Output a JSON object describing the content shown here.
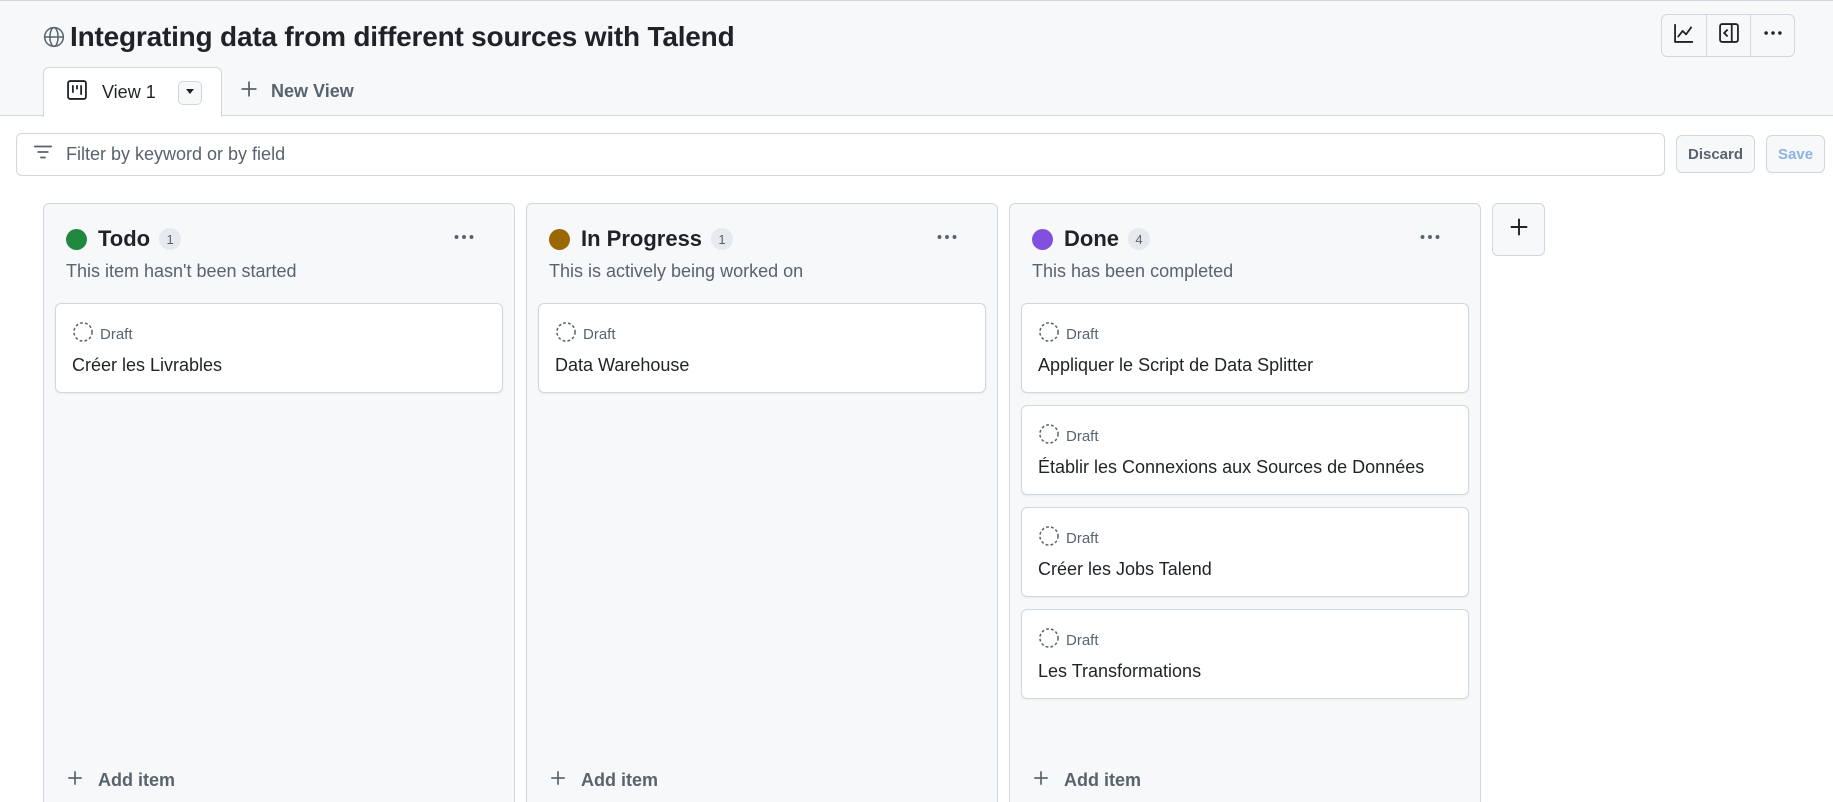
{
  "header": {
    "title": "Integrating data from different sources with Talend",
    "toolbar": [
      "insights-icon",
      "side-panel-icon",
      "kebab-icon"
    ]
  },
  "tabs": {
    "active_label": "View 1",
    "new_view_label": "New View"
  },
  "filter": {
    "placeholder": "Filter by keyword or by field",
    "discard_label": "Discard",
    "save_label": "Save"
  },
  "columns": [
    {
      "name": "Todo",
      "count": "1",
      "color": "#1f883d",
      "description": "This item hasn't been started",
      "add_label": "Add item",
      "cards": [
        {
          "status": "Draft",
          "title": "Créer les Livrables"
        }
      ]
    },
    {
      "name": "In Progress",
      "count": "1",
      "color": "#9a6700",
      "description": "This is actively being worked on",
      "add_label": "Add item",
      "cards": [
        {
          "status": "Draft",
          "title": "Data Warehouse"
        }
      ]
    },
    {
      "name": "Done",
      "count": "4",
      "color": "#8250df",
      "description": "This has been completed",
      "add_label": "Add item",
      "cards": [
        {
          "status": "Draft",
          "title": "Appliquer le Script de Data Splitter"
        },
        {
          "status": "Draft",
          "title": "Établir les Connexions aux Sources de Données"
        },
        {
          "status": "Draft",
          "title": "Créer les Jobs Talend"
        },
        {
          "status": "Draft",
          "title": "Les Transformations"
        }
      ]
    }
  ],
  "colors": {
    "background": "#f6f8fa",
    "border": "#d0d7de",
    "text": "#1f2328",
    "muted": "#59636e"
  }
}
